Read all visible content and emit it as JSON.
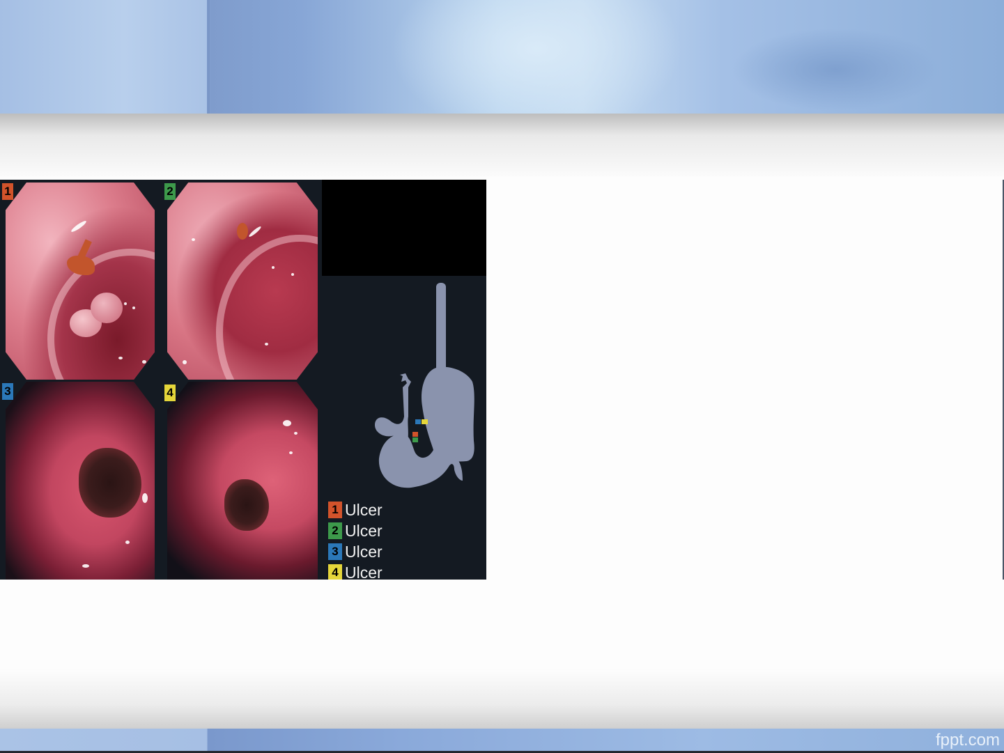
{
  "footer": {
    "brand": "fppt.com"
  },
  "figure": {
    "panels": [
      {
        "number": "1",
        "color": "#d2532b"
      },
      {
        "number": "2",
        "color": "#3d9a4b"
      },
      {
        "number": "3",
        "color": "#2b78b9"
      },
      {
        "number": "4",
        "color": "#e5d63a"
      }
    ],
    "legend": [
      {
        "number": "1",
        "label": "Ulcer",
        "color": "#d2532b"
      },
      {
        "number": "2",
        "label": "Ulcer",
        "color": "#3d9a4b"
      },
      {
        "number": "3",
        "label": "Ulcer",
        "color": "#2b78b9"
      },
      {
        "number": "4",
        "label": "Ulcer",
        "color": "#e5d63a"
      }
    ],
    "diagram_icon": "stomach-diagram-icon"
  }
}
